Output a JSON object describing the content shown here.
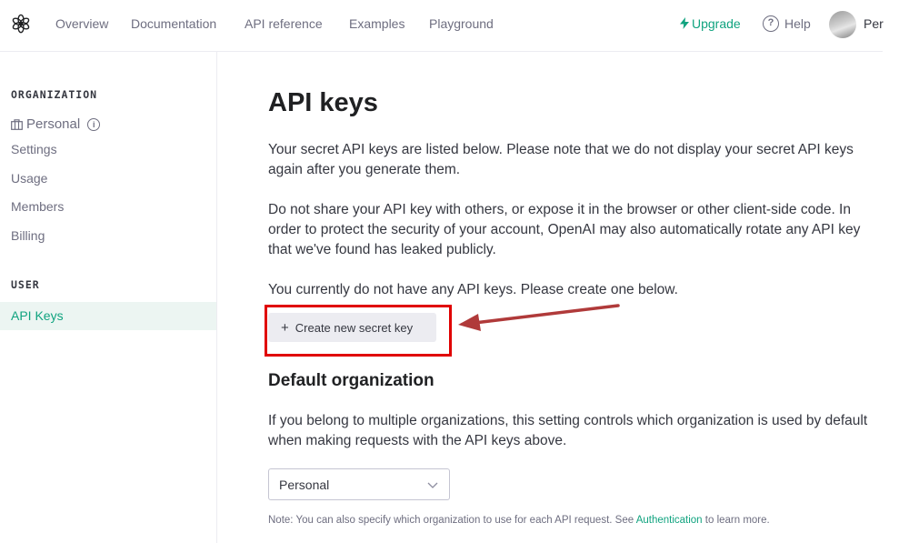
{
  "nav": {
    "links": [
      "Overview",
      "Documentation",
      "API reference",
      "Examples",
      "Playground"
    ],
    "upgrade": "Upgrade",
    "help": "Help",
    "user_name": "Per"
  },
  "sidebar": {
    "org_heading": "ORGANIZATION",
    "org_name": "Personal",
    "org_items": [
      "Settings",
      "Usage",
      "Members",
      "Billing"
    ],
    "user_heading": "USER",
    "user_items": [
      "API Keys"
    ]
  },
  "main": {
    "title": "API keys",
    "para1": "Your secret API keys are listed below. Please note that we do not display your secret API keys again after you generate them.",
    "para2": "Do not share your API key with others, or expose it in the browser or other client-side code. In order to protect the security of your account, OpenAI may also automatically rotate any API key that we've found has leaked publicly.",
    "para3": "You currently do not have any API keys. Please create one below.",
    "create_button": "Create new secret key",
    "default_org_heading": "Default organization",
    "default_org_desc": "If you belong to multiple organizations, this setting controls which organization is used by default when making requests with the API keys above.",
    "org_select_value": "Personal",
    "note_prefix": "Note: You can also specify which organization to use for each API request. See",
    "note_link": "Authentication",
    "note_suffix": "to learn more."
  },
  "colors": {
    "accent": "#10a37f",
    "highlight": "#e00000",
    "arrow": "#b03a3a"
  },
  "icons": {
    "logo": "openai-logo-icon",
    "upgrade": "lightning-bolt-icon",
    "help": "question-circle-icon",
    "org": "briefcase-icon",
    "info": "info-circle-icon",
    "plus": "plus-icon",
    "chevron": "chevron-down-icon"
  }
}
